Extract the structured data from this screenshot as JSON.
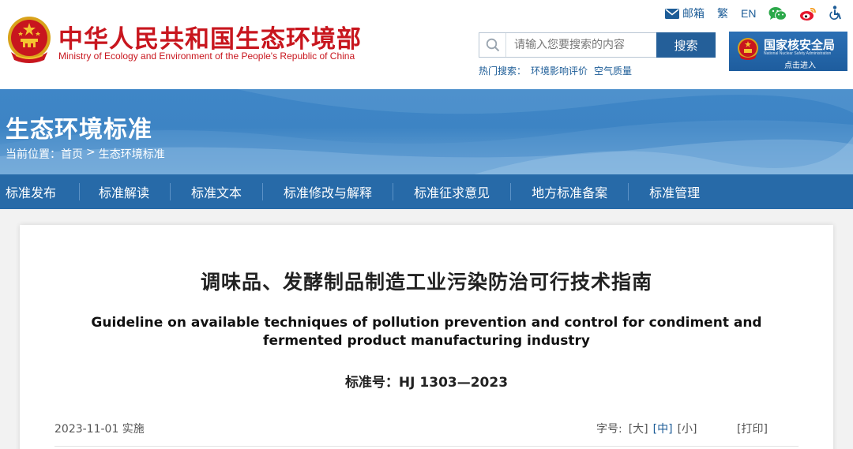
{
  "header": {
    "title_cn": "中华人民共和国生态环境部",
    "title_en": "Ministry of Ecology and Environment of the People's Republic of China",
    "top_links": {
      "mail": "邮箱",
      "traditional": "繁",
      "english": "EN"
    },
    "search": {
      "placeholder": "请输入您要搜索的内容",
      "button": "搜索"
    },
    "hot_search": {
      "label": "热门搜索：",
      "items": [
        "环境影响评价",
        "空气质量"
      ]
    },
    "nnsa_banner": {
      "title_cn": "国家核安全局",
      "title_en": "National Nuclear Safety Administration",
      "enter": "点击进入"
    }
  },
  "banner": {
    "title": "生态环境标准",
    "breadcrumb": {
      "label": "当前位置：",
      "home": "首页",
      "separator": ">",
      "current": "生态环境标准"
    }
  },
  "nav": {
    "items": [
      "标准发布",
      "标准解读",
      "标准文本",
      "标准修改与解释",
      "标准征求意见",
      "地方标准备案",
      "标准管理"
    ]
  },
  "article": {
    "title_cn": "调味品、发酵制品制造工业污染防治可行技术指南",
    "title_en": "Guideline on available techniques of pollution prevention and control for condiment and fermented product manufacturing industry",
    "standard_no": "标准号：HJ 1303—2023",
    "implementation": "2023-11-01 实施",
    "font_size": {
      "label": "字号:",
      "large": "[大]",
      "medium": "[中]",
      "small": "[小]"
    },
    "print": "[打印]"
  },
  "colors": {
    "brand_red": "#c8161e",
    "nav_blue": "#276aa8",
    "link_blue": "#1c5c97",
    "search_button": "#245f99"
  }
}
